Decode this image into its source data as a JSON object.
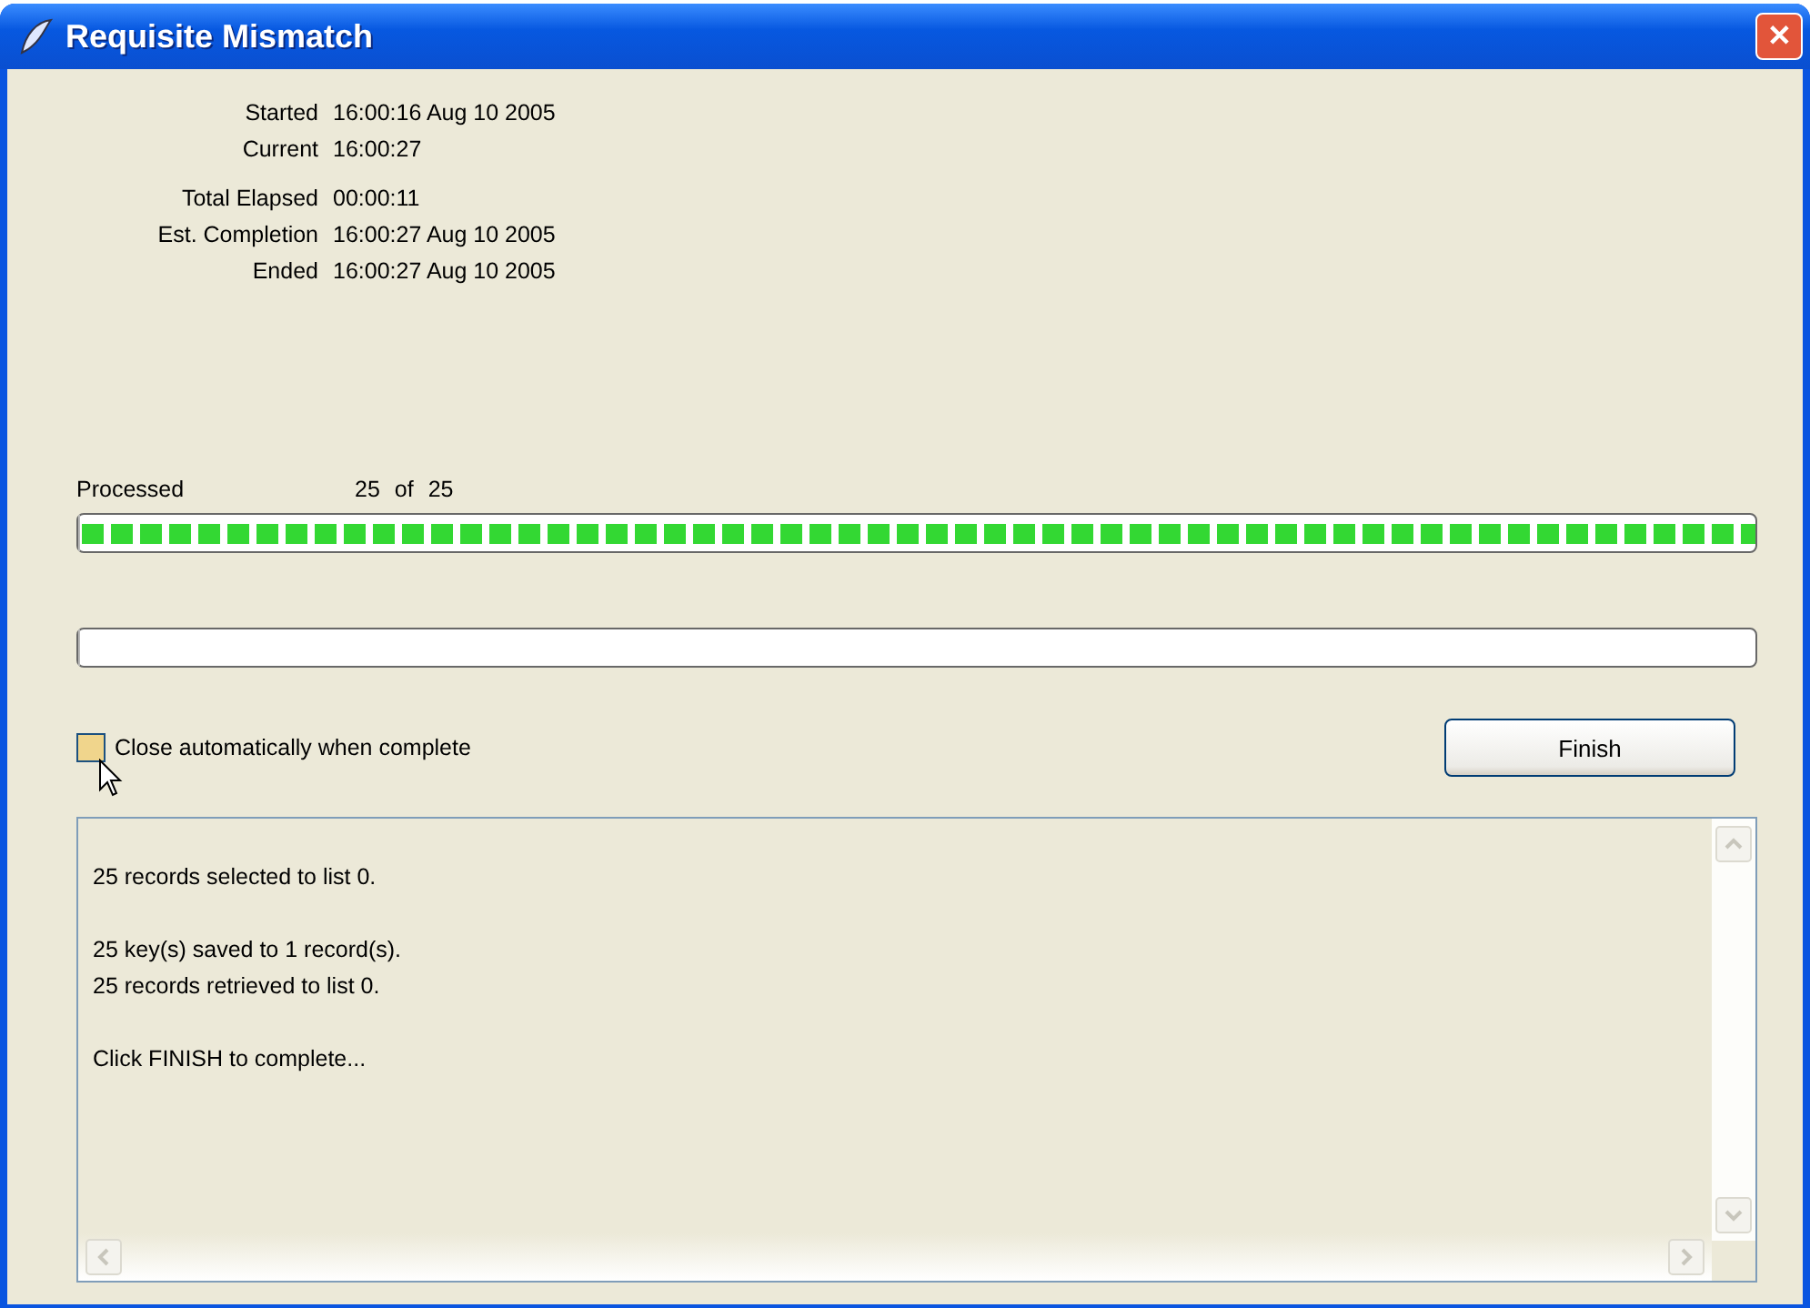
{
  "window": {
    "title": "Requisite Mismatch",
    "close": "✕"
  },
  "time_groups": [
    [
      {
        "label": "Started",
        "value": "16:00:16 Aug 10 2005"
      },
      {
        "label": "Current",
        "value": "16:00:27"
      }
    ],
    [
      {
        "label": "Total Elapsed",
        "value": "00:00:11"
      },
      {
        "label": "Est. Completion",
        "value": "16:00:27 Aug 10 2005"
      },
      {
        "label": "Ended",
        "value": "16:00:27 Aug 10 2005"
      }
    ]
  ],
  "processed": {
    "label": "Processed",
    "count": "25",
    "of": "of",
    "total": "25"
  },
  "progress_bars": [
    {
      "level": 1
    },
    {
      "level": 0
    }
  ],
  "auto_close": {
    "label": "Close automatically when complete",
    "checked": false
  },
  "finish_button": "Finish",
  "log": [
    [
      "25 records selected to list 0."
    ],
    [
      "25 key(s) saved to 1 record(s).",
      "25 records retrieved to list 0."
    ],
    [
      "Click FINISH to complete..."
    ]
  ]
}
